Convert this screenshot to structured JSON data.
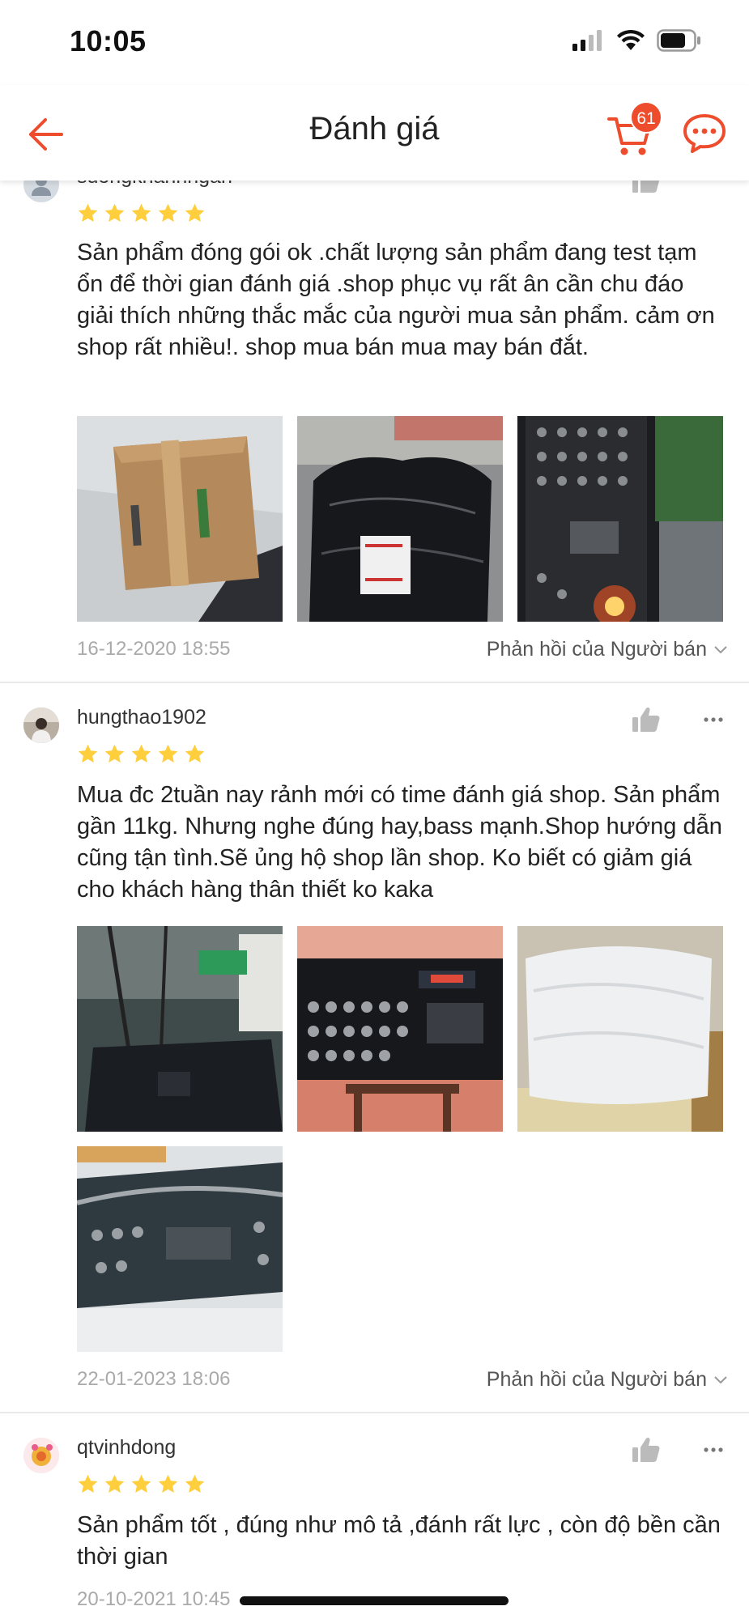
{
  "status_bar": {
    "time": "10:05"
  },
  "header": {
    "title": "Đánh giá",
    "cart_badge": "61",
    "accent_color": "#ee4d2d"
  },
  "reviews": [
    {
      "username": "suongkhanhngan",
      "rating": 5,
      "text": "Sản phẩm đóng gói ok .chất lượng sản phẩm đang test tạm ổn để thời gian đánh giá .shop phục vụ rất ân cần chu đáo giải thích những thắc mắc của người mua sản phẩm. cảm ơn shop rất nhiều!. shop mua bán mua may bán đắt.",
      "photos": [
        "cardboard-box-photo",
        "black-wrapped-package-photo",
        "amplifier-panel-led-photo"
      ],
      "date": "16-12-2020 18:55",
      "seller_reply": "Phản hồi của Người bán"
    },
    {
      "username": "hungthao1902",
      "rating": 5,
      "text": "Mua đc 2tuần nay rảnh mới có time đánh giá shop. Sản phẩm gần 11kg. Nhưng nghe đúng hay,bass mạnh.Shop hướng dẫn cũng tận tình.Sẽ ủng hộ shop lần shop. Ko biết có giảm giá cho khách hàng thân thiết ko kaka",
      "photos": [
        "amplifier-on-floor-photo",
        "amplifier-front-panel-photo",
        "white-wrapped-package-photo",
        "amplifier-in-plastic-photo"
      ],
      "date": "22-01-2023 18:06",
      "seller_reply": "Phản hồi của Người bán"
    },
    {
      "username": "qtvinhdong",
      "rating": 5,
      "text": "Sản phẩm tốt , đúng như mô tả ,đánh rất lực , còn độ bền cần thời gian",
      "photos": [],
      "date": "20-10-2021 10:45",
      "seller_reply": ""
    }
  ]
}
